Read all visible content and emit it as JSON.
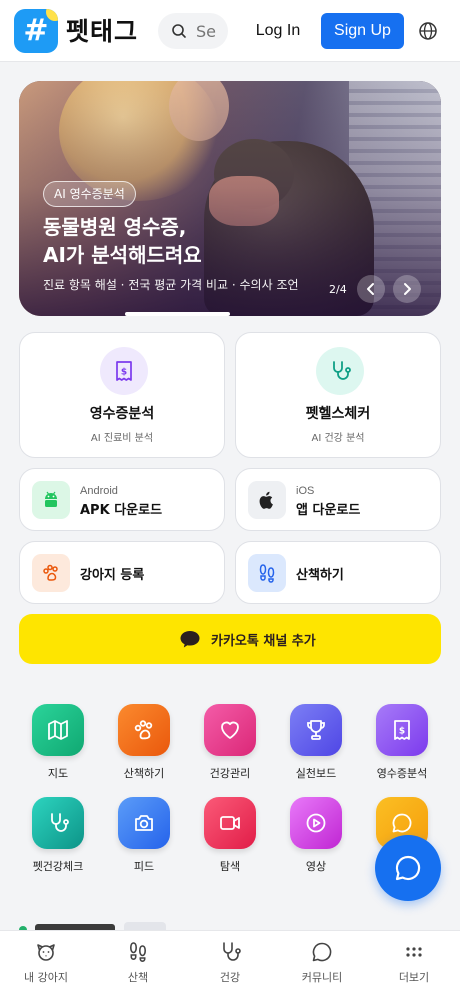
{
  "header": {
    "brand": "펫태그",
    "search_placeholder": "Se",
    "login_label": "Log In",
    "signup_label": "Sign Up",
    "accent": "#1670f0"
  },
  "hero": {
    "tag": "AI 영수증분석",
    "title_line1": "동물병원 영수증,",
    "title_line2": "AI가 분석해드려요",
    "subtitle": "진료 항목 해설 · 전국 평균 가격 비교 · 수의사 조언",
    "counter": "2/4",
    "progress": 0.25
  },
  "feature_cards": [
    {
      "title": "영수증분석",
      "subtitle": "AI 진료비 분석",
      "icon": "receipt-icon"
    },
    {
      "title": "펫헬스체커",
      "subtitle": "AI 건강 분석",
      "icon": "stethoscope-icon"
    }
  ],
  "downloads": [
    {
      "platform": "Android",
      "label": "APK 다운로드",
      "icon": "android-icon"
    },
    {
      "platform": "iOS",
      "label": "앱 다운로드",
      "icon": "apple-icon"
    }
  ],
  "quick_actions": [
    {
      "label": "강아지 등록",
      "icon": "paw-icon"
    },
    {
      "label": "산책하기",
      "icon": "footprints-icon"
    }
  ],
  "kakao": {
    "label": "카카오톡 채널 추가",
    "icon": "chat-bubble-icon",
    "color": "#fee500"
  },
  "menu_grid": [
    {
      "label": "지도",
      "icon": "map-icon",
      "color": "#1fbf87"
    },
    {
      "label": "산책하기",
      "icon": "paw-icon",
      "color": "#f97316"
    },
    {
      "label": "건강관리",
      "icon": "heart-icon",
      "color": "#ec4899"
    },
    {
      "label": "실천보드",
      "icon": "trophy-icon",
      "color": "#6366f1"
    },
    {
      "label": "영수증분석",
      "icon": "receipt-icon",
      "color": "#8b5cf6"
    },
    {
      "label": "펫건강체크",
      "icon": "stethoscope-icon",
      "color": "#14b8a6"
    },
    {
      "label": "피드",
      "icon": "camera-icon",
      "color": "#3b82f6"
    },
    {
      "label": "탐색",
      "icon": "video-icon",
      "color": "#f43f5e"
    },
    {
      "label": "영상",
      "icon": "play-icon",
      "color": "#d946ef"
    },
    {
      "label": "",
      "icon": "chat-bubble-icon",
      "color": "#f59e0b"
    }
  ],
  "bottom_nav": [
    {
      "label": "내 강아지",
      "icon": "dog-face-icon"
    },
    {
      "label": "산책",
      "icon": "footprints-icon"
    },
    {
      "label": "건강",
      "icon": "stethoscope-icon"
    },
    {
      "label": "커뮤니티",
      "icon": "chat-bubble-icon"
    },
    {
      "label": "더보기",
      "icon": "more-dots-icon"
    }
  ]
}
